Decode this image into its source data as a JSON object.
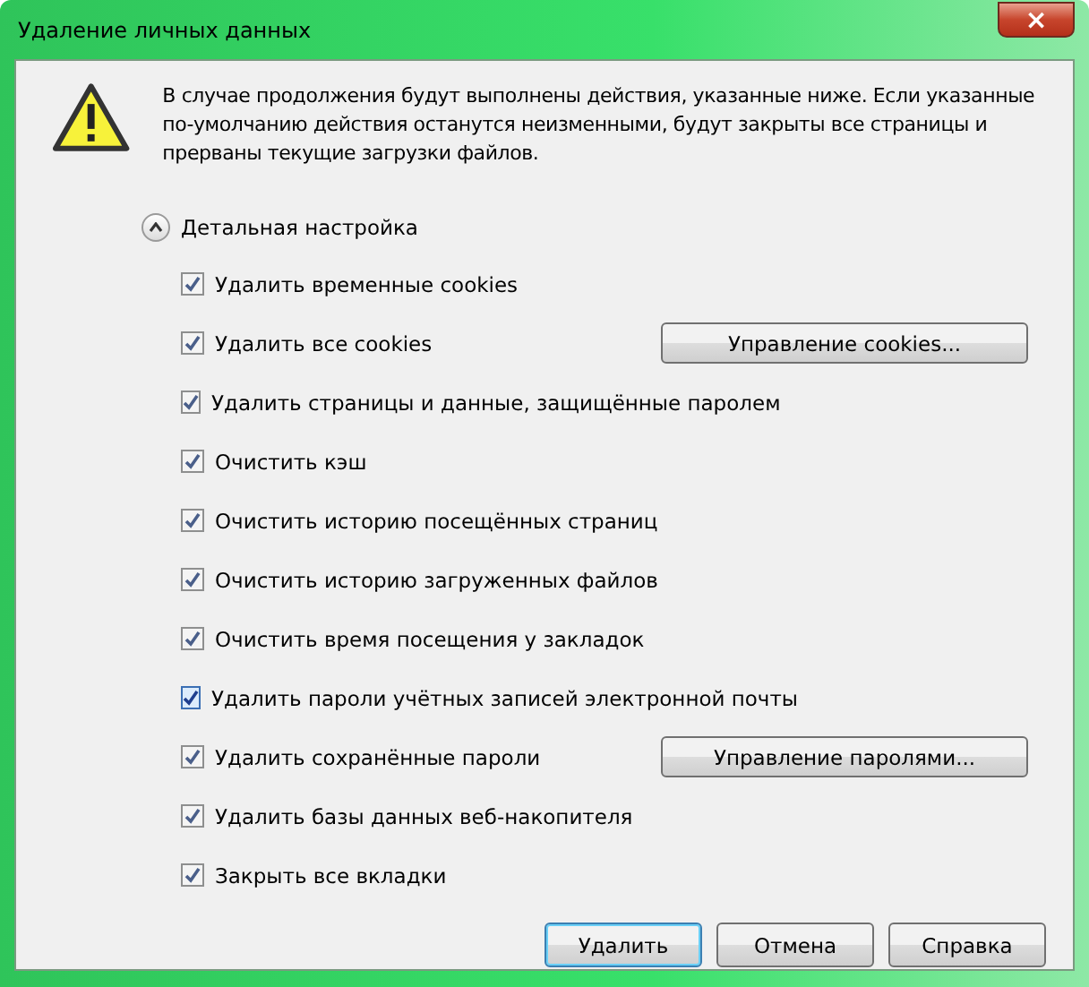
{
  "window": {
    "title": "Удаление личных данных",
    "close": "×"
  },
  "message": "В случае продолжения будут выполнены действия, указанные ниже. Если указанные по-умолчанию действия останутся неизменными, будут закрыты все страницы и прерваны текущие загрузки файлов.",
  "details": {
    "label": "Детальная настройка",
    "expanded": true
  },
  "options": [
    {
      "label": "Удалить временные cookies",
      "checked": true,
      "highlighted": false
    },
    {
      "label": "Удалить все cookies",
      "checked": true,
      "highlighted": false,
      "button": "Управление cookies..."
    },
    {
      "label": "Удалить страницы и данные, защищённые паролем",
      "checked": true,
      "highlighted": false
    },
    {
      "label": "Очистить кэш",
      "checked": true,
      "highlighted": false
    },
    {
      "label": "Очистить историю посещённых страниц",
      "checked": true,
      "highlighted": false
    },
    {
      "label": "Очистить историю загруженных файлов",
      "checked": true,
      "highlighted": false
    },
    {
      "label": "Очистить время посещения у закладок",
      "checked": true,
      "highlighted": false
    },
    {
      "label": "Удалить пароли учётных записей электронной почты",
      "checked": true,
      "highlighted": true
    },
    {
      "label": "Удалить сохранённые пароли",
      "checked": true,
      "highlighted": false,
      "button": "Управление паролями..."
    },
    {
      "label": "Удалить базы данных веб-накопителя",
      "checked": true,
      "highlighted": false
    },
    {
      "label": "Закрыть все вкладки",
      "checked": true,
      "highlighted": false
    }
  ],
  "buttons": [
    {
      "label": "Удалить",
      "default": true
    },
    {
      "label": "Отмена",
      "default": false
    },
    {
      "label": "Справка",
      "default": false
    }
  ]
}
